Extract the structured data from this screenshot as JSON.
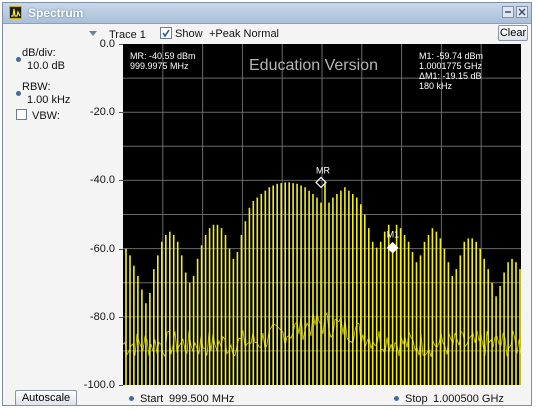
{
  "window": {
    "title": "Spectrum"
  },
  "toolbar": {
    "trace_label": "Trace 1",
    "show_label": "Show",
    "show_checked": true,
    "peak_label": "+Peak Normal",
    "clear_label": "Clear"
  },
  "settings": {
    "db_div_label": "dB/div:",
    "db_div_value": "10.0 dB",
    "rbw_label": "RBW:",
    "rbw_value": "1.00 kHz",
    "vbw_label": "VBW:",
    "vbw_checked": false
  },
  "plot": {
    "watermark": "Education Version",
    "mr_readout_level": "MR: -40.59 dBm",
    "mr_readout_freq": "999.9975 MHz",
    "m1_readout_level": "M1: -59.74 dBm",
    "m1_readout_freq": "1.0001775 GHz",
    "delta_readout_level": "ΔM1: -19.15 dB",
    "delta_readout_freq": "180 kHz",
    "mr_marker_label": "MR",
    "m1_marker_label": "M1",
    "trace_color": "#f2ee1e",
    "background_color": "#000000",
    "grid_color": "#6a6a6a"
  },
  "chart_data": {
    "type": "line",
    "yticks": [
      "0.0",
      "-20.0",
      "-40.0",
      "-60.0",
      "-80.0",
      "-100.0"
    ],
    "ylim": [
      -100,
      0
    ],
    "xlim": [
      999.5,
      1000.5
    ],
    "x_unit": "MHz",
    "series": [
      {
        "values_note": "",
        "x": [
          999.5075,
          999.5175,
          999.5275,
          999.5375,
          999.5475,
          999.5575,
          999.5675,
          999.5775,
          999.5875,
          999.5975,
          999.6075,
          999.6175,
          999.6275,
          999.6375,
          999.6475,
          999.6575,
          999.6675,
          999.6775,
          999.6875,
          999.6975,
          999.7075,
          999.7175,
          999.7275,
          999.7375,
          999.7475,
          999.7575,
          999.7675,
          999.7775,
          999.7875,
          999.7975,
          999.8075,
          999.8175,
          999.8275,
          999.8375,
          999.8475,
          999.8575,
          999.8675,
          999.8775,
          999.8875,
          999.8975,
          999.9075,
          999.9175,
          999.9275,
          999.9375,
          999.9475,
          999.9575,
          999.9675,
          999.9775,
          999.9875,
          999.9975,
          1000.0075,
          1000.0175,
          1000.0275,
          1000.0375,
          1000.0475,
          1000.0575,
          1000.0675,
          1000.0775,
          1000.0875,
          1000.0975,
          1000.1075,
          1000.1175,
          1000.1275,
          1000.1375,
          1000.1475,
          1000.1575,
          1000.1675,
          1000.1775,
          1000.1875,
          1000.1975,
          1000.2075,
          1000.2175,
          1000.2275,
          1000.2375,
          1000.2475,
          1000.2575,
          1000.2675,
          1000.2775,
          1000.2875,
          1000.2975,
          1000.3075,
          1000.3175,
          1000.3275,
          1000.3375,
          1000.3475,
          1000.3575,
          1000.3675,
          1000.3775,
          1000.3875,
          1000.3975,
          1000.4075,
          1000.4175,
          1000.4275,
          1000.4375,
          1000.4475,
          1000.4575,
          1000.4675,
          1000.4775,
          1000.4875,
          1000.4975
        ],
        "values": [
          -60,
          -62,
          -65,
          -68,
          -72,
          -76,
          -73,
          -66,
          -62,
          -58,
          -56,
          -55,
          -56,
          -58,
          -62,
          -67,
          -70,
          -68,
          -63,
          -59,
          -56,
          -54,
          -53,
          -53,
          -54,
          -56,
          -60,
          -63,
          -61,
          -56,
          -52,
          -48,
          -46,
          -45,
          -44,
          -43,
          -42,
          -41.5,
          -41,
          -40.8,
          -40.6,
          -40.6,
          -40.8,
          -41,
          -41.5,
          -42,
          -43,
          -44,
          -45,
          -46.5,
          -40.6,
          -46.5,
          -45,
          -44,
          -43,
          -42,
          -43,
          -44,
          -45,
          -47,
          -50,
          -54,
          -58,
          -59.7,
          -58,
          -55,
          -53,
          -59.74,
          -53,
          -54,
          -56,
          -58,
          -61,
          -64,
          -62,
          -58,
          -56,
          -54,
          -55,
          -57,
          -60,
          -64,
          -68,
          -66,
          -62,
          -58,
          -57,
          -57,
          -58,
          -60,
          -63,
          -66,
          -70,
          -74,
          -71,
          -67,
          -64,
          -63,
          -64,
          -66
        ]
      }
    ],
    "noise_floor_dbm": -88,
    "markers": [
      {
        "name": "MR",
        "x": 999.9975,
        "y": -40.59
      },
      {
        "name": "M1",
        "x": 1000.1775,
        "y": -59.74
      }
    ],
    "start_label": "Start",
    "start_value": "999.500 MHz",
    "stop_label": "Stop",
    "stop_value": "1.000500 GHz"
  },
  "footer": {
    "autoscale_label": "Autoscale"
  }
}
